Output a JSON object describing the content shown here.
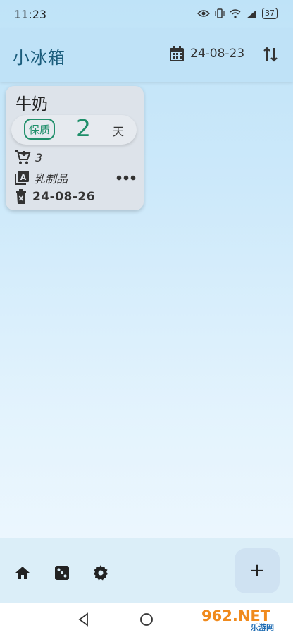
{
  "status_bar": {
    "time": "11:23",
    "battery": "37"
  },
  "app_bar": {
    "title": "小冰箱",
    "date": "24-08-23"
  },
  "item_card": {
    "name": "牛奶",
    "shelf_label": "保质",
    "shelf_days": "2",
    "shelf_unit": "天",
    "quantity": "3",
    "category": "乳制品",
    "expiry_date": "24-08-26"
  },
  "fab": {
    "label": "+"
  },
  "watermark": {
    "main": "962.NET",
    "sub": "乐游网"
  },
  "colors": {
    "accent": "#1f8f6a",
    "title": "#1b5d7c",
    "appbar": "#bfe2f7"
  }
}
